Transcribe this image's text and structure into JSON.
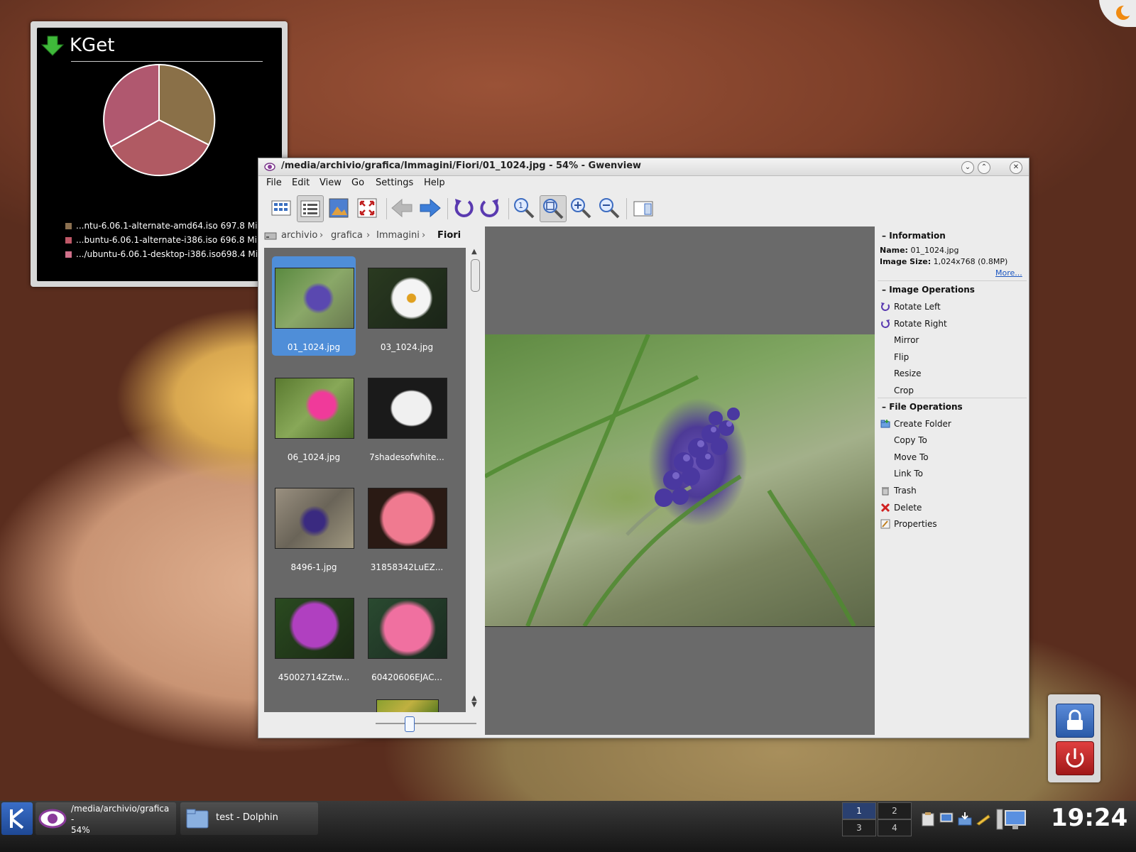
{
  "kget": {
    "title": "KGet",
    "downloads": [
      {
        "label": "...ntu-6.06.1-alternate-amd64.iso",
        "size": "697.8 Mi",
        "color": "#8b7050"
      },
      {
        "label": "...buntu-6.06.1-alternate-i386.iso",
        "size": "696.8 Mi",
        "color": "#b25a6a"
      },
      {
        "label": ".../ubuntu-6.06.1-desktop-i386.iso",
        "size": "698.4 Mi",
        "color": "#c77090"
      }
    ]
  },
  "window": {
    "title": "/media/archivio/grafica/Immagini/Fiori/01_1024.jpg - 54% - Gwenview",
    "menu": [
      "File",
      "Edit",
      "View",
      "Go",
      "Settings",
      "Help"
    ]
  },
  "breadcrumb": {
    "items": [
      "archivio",
      "grafica",
      "Immagini"
    ],
    "current": "Fiori"
  },
  "thumbnails": [
    {
      "name": "01_1024.jpg",
      "selected": true
    },
    {
      "name": "03_1024.jpg"
    },
    {
      "name": "06_1024.jpg"
    },
    {
      "name": "7shadesofwhite..."
    },
    {
      "name": "8496-1.jpg"
    },
    {
      "name": "31858342LuEZ..."
    },
    {
      "name": "45002714Zztw..."
    },
    {
      "name": "60420606EJAC..."
    }
  ],
  "sidebar": {
    "information": {
      "header": "Information",
      "name_label": "Name:",
      "name_value": "01_1024.jpg",
      "size_label": "Image Size:",
      "size_value": "1,024x768 (0.8MP)",
      "more": "More..."
    },
    "image_ops": {
      "header": "Image Operations",
      "items": [
        "Rotate Left",
        "Rotate Right",
        "Mirror",
        "Flip",
        "Resize",
        "Crop"
      ]
    },
    "file_ops": {
      "header": "File Operations",
      "items": [
        "Create Folder",
        "Copy To",
        "Move To",
        "Link To",
        "Trash",
        "Delete",
        "Properties"
      ]
    }
  },
  "taskbar": {
    "tasks": [
      {
        "line1": "/media/archivio/grafica",
        "line2": "-",
        "line3": "54%"
      },
      {
        "line1": "test - Dolphin"
      }
    ],
    "pager": [
      "1",
      "2",
      "3",
      "4"
    ],
    "clock": "19:24"
  }
}
